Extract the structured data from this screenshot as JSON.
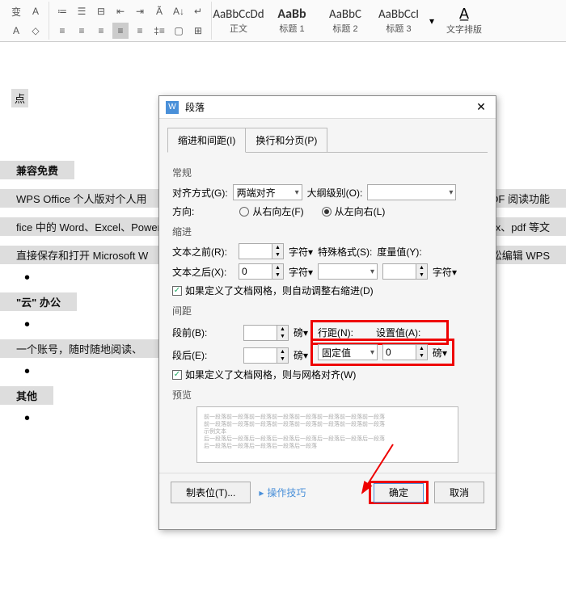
{
  "ribbon": {
    "styles": [
      {
        "preview": "AaBbCcDd",
        "label": "正文"
      },
      {
        "preview": "AaBb",
        "label": "标题 1"
      },
      {
        "preview": "AaBbC",
        "label": "标题 2"
      },
      {
        "preview": "AaBbCcI",
        "label": "标题 3"
      }
    ],
    "typeset": "文字排版"
  },
  "doc": {
    "h1": "兼容免费",
    "p1": "WPS Office 个人版对个人用",
    "p1r": "PDF 阅读功能",
    "p2": "fice 中的 Word、Excel、PowerP",
    "p2r": "ptx、pdf 等文",
    "p3": "直接保存和打开  Microsoft W",
    "p3r": "轻松编辑 WPS",
    "h2": "\"云\" 办公",
    "p4": "一个账号，随时随地阅读、",
    "h3": "其他"
  },
  "dialog": {
    "title": "段落",
    "tab1": "缩进和间距(I)",
    "tab2": "换行和分页(P)",
    "sect_general": "常规",
    "align_label": "对齐方式(G):",
    "align_value": "两端对齐",
    "outline_label": "大纲级别(O):",
    "outline_value": "",
    "dir_label": "方向:",
    "rtl": "从右向左(F)",
    "ltr": "从左向右(L)",
    "sect_indent": "缩进",
    "text_before": "文本之前(R):",
    "text_after": "文本之后(X):",
    "text_after_val": "0",
    "char_unit": "字符",
    "special_fmt": "特殊格式(S):",
    "measure": "度量值(Y):",
    "grid_indent": "如果定义了文档网格，则自动调整右缩进(D)",
    "sect_spacing": "间距",
    "space_before": "段前(B):",
    "space_after": "段后(E):",
    "pt_unit": "磅",
    "line_spacing": "行距(N):",
    "line_spacing_val": "固定值",
    "set_value": "设置值(A):",
    "set_value_val": "0",
    "grid_snap": "如果定义了文档网格，则与网格对齐(W)",
    "sect_preview": "预览",
    "tabstops_btn": "制表位(T)...",
    "tips": "操作技巧",
    "ok": "确定",
    "cancel": "取消"
  }
}
